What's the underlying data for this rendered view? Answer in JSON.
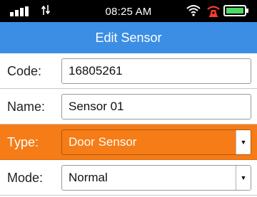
{
  "status_bar": {
    "time": "08:25 AM",
    "icons": [
      "signal-icon",
      "data-transfer-icon",
      "wifi-icon",
      "alarm-icon",
      "battery-icon"
    ]
  },
  "header": {
    "title": "Edit Sensor"
  },
  "form": {
    "code": {
      "label": "Code:",
      "value": "16805261"
    },
    "name": {
      "label": "Name:",
      "value": "Sensor 01"
    },
    "type": {
      "label": "Type:",
      "value": "Door Sensor"
    },
    "mode": {
      "label": "Mode:",
      "value": "Normal"
    }
  },
  "colors": {
    "status_bar": "#000000",
    "header": "#3b8ee4",
    "highlight_row": "#f57c16",
    "battery": "#4cd964",
    "alarm": "#ff3b30"
  }
}
